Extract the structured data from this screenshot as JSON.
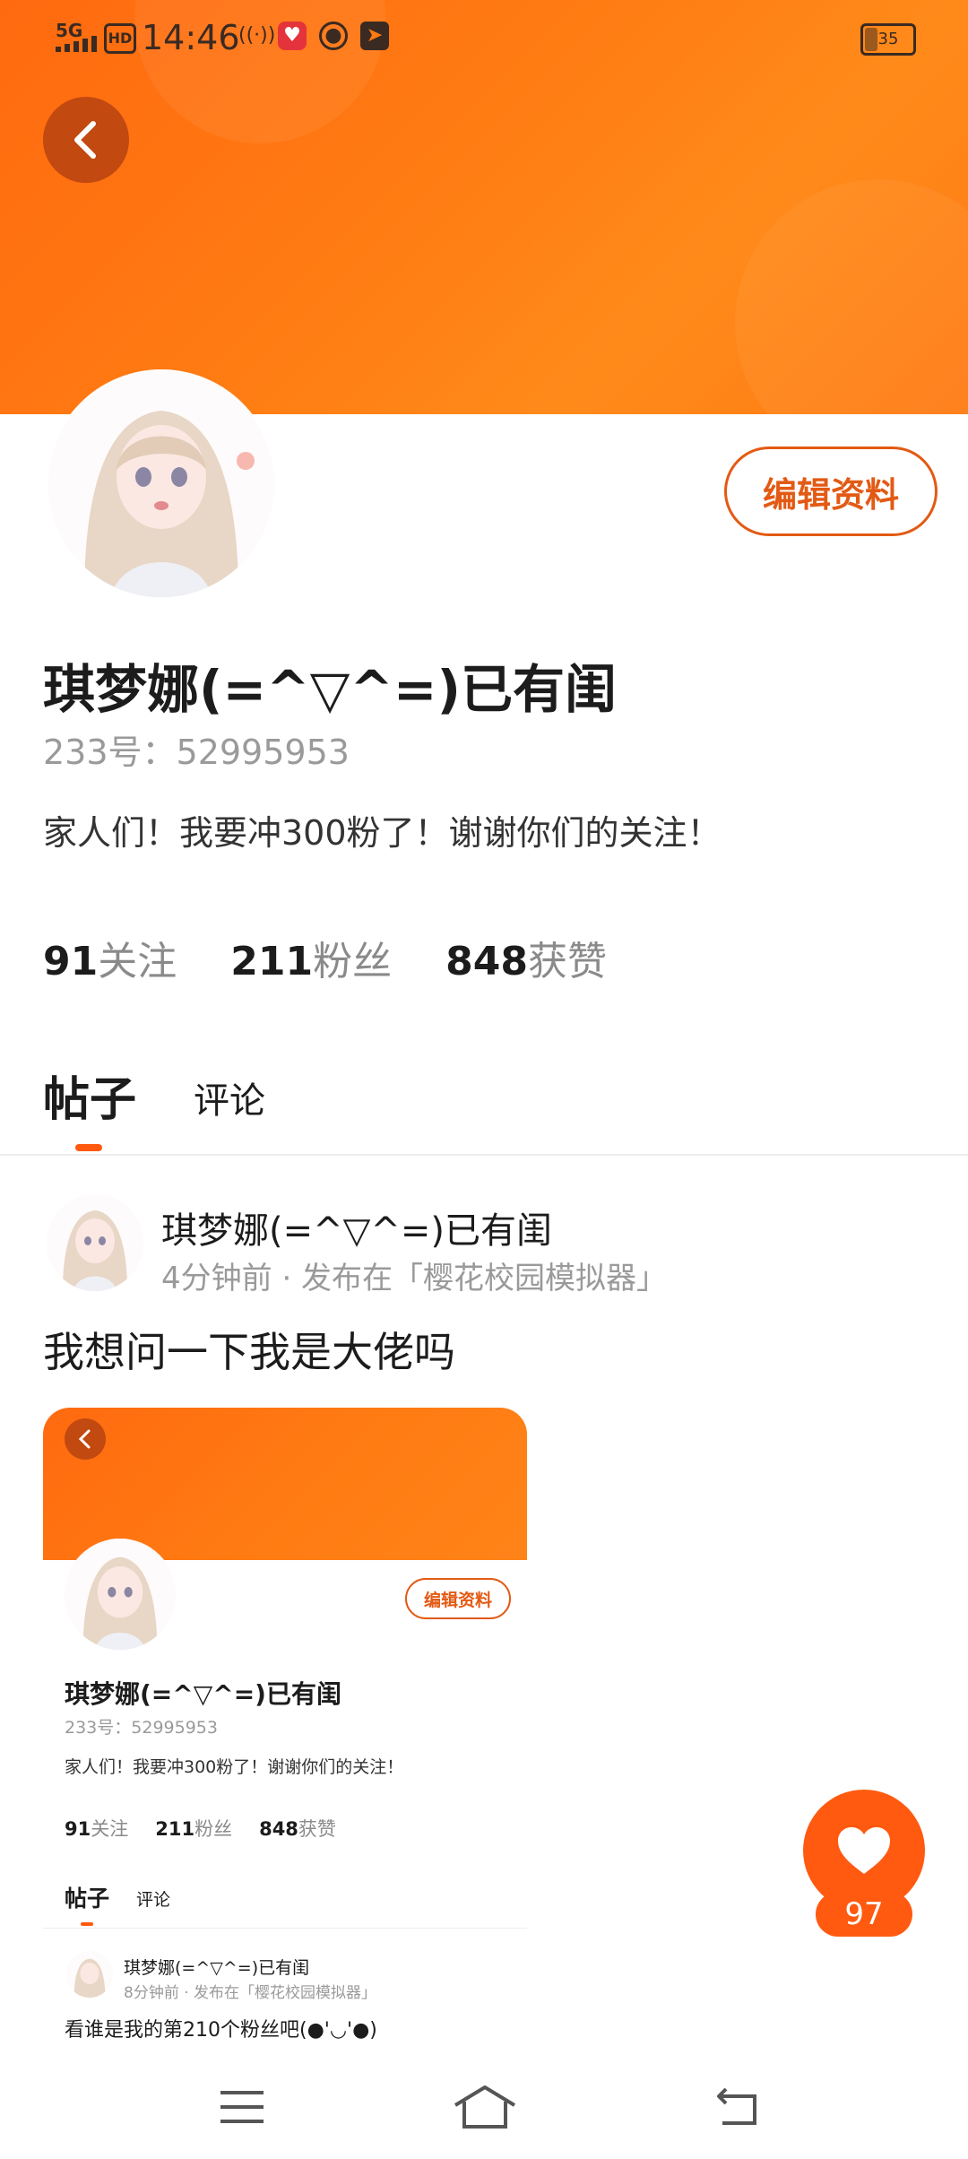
{
  "status_bar": {
    "network": "5G",
    "hd": "HD",
    "time": "14:46",
    "battery": "35"
  },
  "profile": {
    "name": "琪梦娜(=^▽^=)已有闺",
    "uid": "233号：52995953",
    "bio": "家人们！我要冲300粉了！谢谢你们的关注！",
    "edit_label": "编辑资料",
    "stats": [
      {
        "num": "91",
        "label": "关注"
      },
      {
        "num": "211",
        "label": "粉丝"
      },
      {
        "num": "848",
        "label": "获赞"
      }
    ]
  },
  "tabs": {
    "posts": "帖子",
    "comments": "评论"
  },
  "post": {
    "author": "琪梦娜(=^▽^=)已有闺",
    "meta": "4分钟前 · 发布在「樱花校园模拟器」",
    "title": "我想问一下我是大佬吗"
  },
  "embedded": {
    "name": "琪梦娜(=^▽^=)已有闺",
    "uid": "233号：52995953",
    "bio": "家人们！我要冲300粉了！谢谢你们的关注！",
    "edit_label": "编辑资料",
    "stats": [
      {
        "num": "91",
        "label": "关注"
      },
      {
        "num": "211",
        "label": "粉丝"
      },
      {
        "num": "848",
        "label": "获赞"
      }
    ],
    "tab_posts": "帖子",
    "tab_comments": "评论",
    "post_author": "琪梦娜(=^▽^=)已有闺",
    "post_meta": "8分钟前 · 发布在「樱花校园模拟器」",
    "post_title": "看谁是我的第210个粉丝吧(●'◡'●)"
  },
  "like": {
    "count": "97"
  },
  "colors": {
    "accent": "#ff5a10",
    "banner": "#ff7a12",
    "back_button": "#c24910"
  }
}
